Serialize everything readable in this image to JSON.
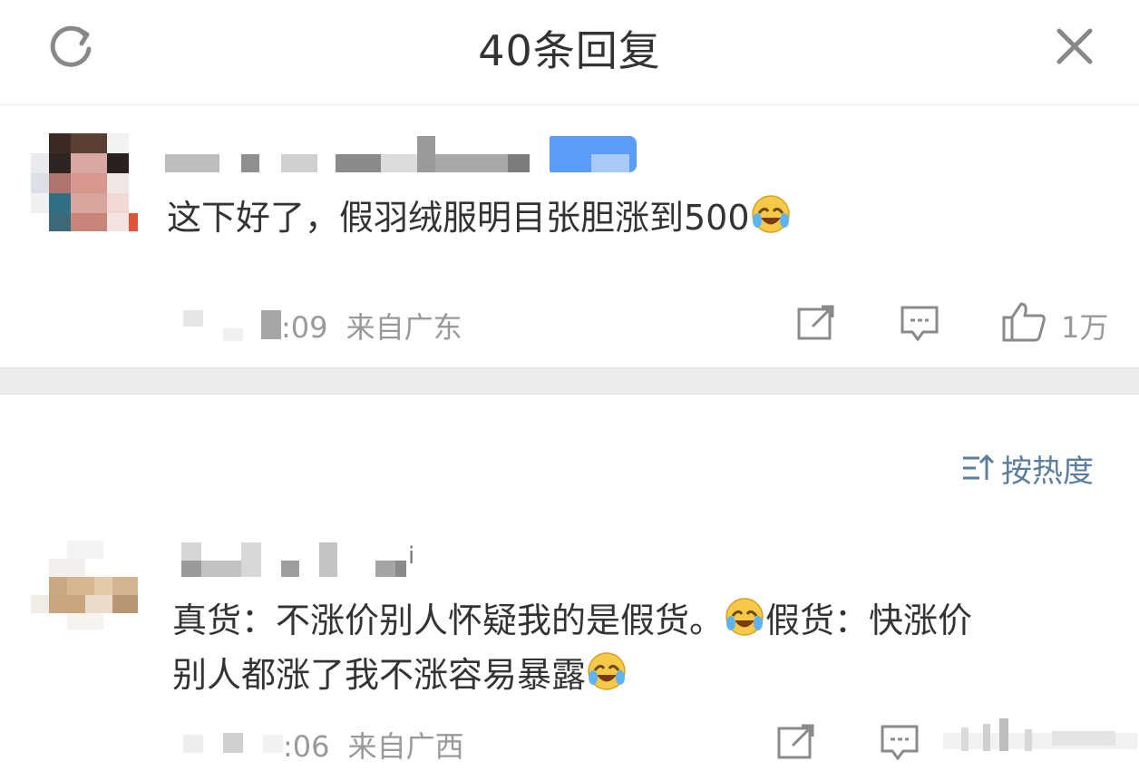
{
  "header": {
    "title": "40条回复",
    "refresh_icon": "refresh-icon",
    "close_icon": "close-icon"
  },
  "comments": [
    {
      "text": "这下好了，假羽绒服明目张胆涨到500",
      "emoji": "laugh-cry-emoji",
      "time": ":09",
      "location": "来自广东",
      "likes": "1万"
    },
    {
      "text_line1": "真货：不涨价别人怀疑我的是假货。",
      "text_line1b": "假货：快涨价",
      "text_line2": "别人都涨了我不涨容易暴露",
      "emoji": "laugh-cry-emoji",
      "time": ":06",
      "location": "来自广西",
      "name_tail": "i"
    }
  ],
  "sort": {
    "label": "按热度",
    "icon": "sort-icon"
  },
  "colors": {
    "accent": "#5b7e9f",
    "verified_blue": "#5a9cf8",
    "muted": "#999999",
    "divider": "#ececec"
  }
}
